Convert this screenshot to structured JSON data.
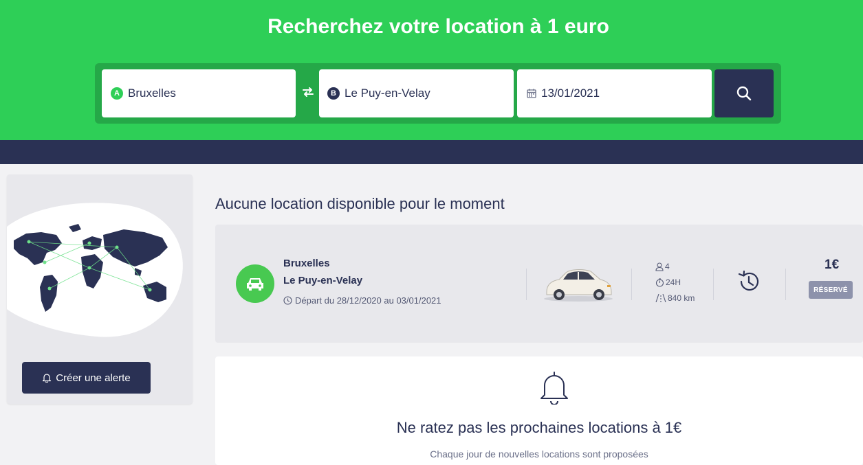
{
  "hero": {
    "title": "Recherchez votre location à 1 euro",
    "from": {
      "badge": "A",
      "value": "Bruxelles"
    },
    "to": {
      "badge": "B",
      "value": "Le Puy-en-Velay"
    },
    "date": {
      "value": "13/01/2021"
    },
    "colors": {
      "hero_bg": "#2ecf57",
      "bar_bg": "#25a848",
      "navy": "#2a3154"
    }
  },
  "sidebar": {
    "alert_label": "Créer une alerte"
  },
  "results": {
    "heading": "Aucune location disponible pour le moment",
    "items": [
      {
        "from_city": "Bruxelles",
        "to_city": "Le Puy-en-Velay",
        "dates": "Départ du 28/12/2020 au 03/01/2021",
        "seats": "4",
        "duration": "24H",
        "distance": "840 km",
        "price": "1€",
        "status": "RÉSERVÉ"
      }
    ]
  },
  "promo": {
    "title": "Ne ratez pas les prochaines locations à 1€",
    "subtitle": "Chaque jour de nouvelles locations sont proposées"
  }
}
